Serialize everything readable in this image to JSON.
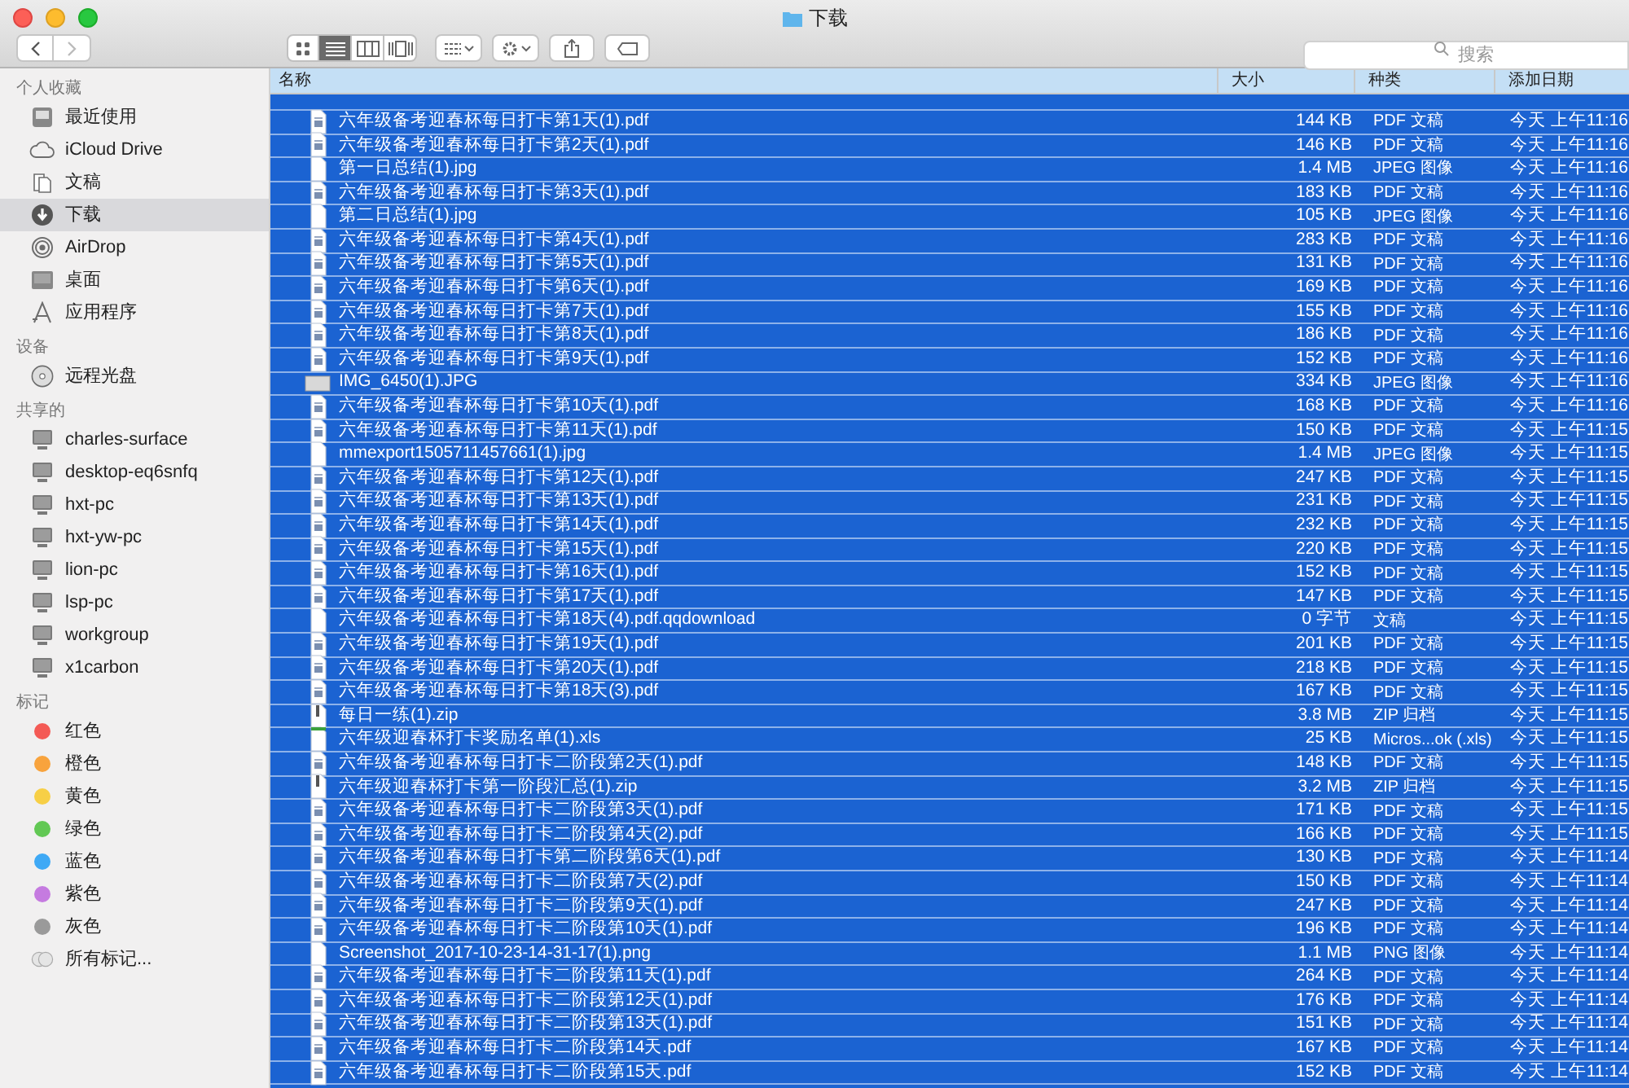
{
  "window": {
    "title": "下载"
  },
  "toolbar": {
    "view_modes": [
      {
        "kind": "icons",
        "selected": false
      },
      {
        "kind": "list",
        "selected": true
      },
      {
        "kind": "columns",
        "selected": false
      },
      {
        "kind": "coverflow",
        "selected": false
      }
    ],
    "search": {
      "placeholder": "搜索"
    }
  },
  "sidebar": {
    "sections": [
      {
        "title": "个人收藏",
        "items": [
          {
            "label": "最近使用",
            "kind": "recents",
            "selected": false
          },
          {
            "label": "iCloud Drive",
            "kind": "cloud",
            "selected": false
          },
          {
            "label": "文稿",
            "kind": "documents",
            "selected": false
          },
          {
            "label": "下载",
            "kind": "downloads",
            "selected": true
          },
          {
            "label": "AirDrop",
            "kind": "airdrop",
            "selected": false
          },
          {
            "label": "桌面",
            "kind": "desktop",
            "selected": false
          },
          {
            "label": "应用程序",
            "kind": "apps",
            "selected": false
          }
        ]
      },
      {
        "title": "设备",
        "items": [
          {
            "label": "远程光盘",
            "kind": "disc",
            "selected": false
          }
        ]
      },
      {
        "title": "共享的",
        "items": [
          {
            "label": "charles-surface",
            "kind": "computer",
            "selected": false
          },
          {
            "label": "desktop-eq6snfq",
            "kind": "computer",
            "selected": false
          },
          {
            "label": "hxt-pc",
            "kind": "computer",
            "selected": false
          },
          {
            "label": "hxt-yw-pc",
            "kind": "computer",
            "selected": false
          },
          {
            "label": "lion-pc",
            "kind": "computer",
            "selected": false
          },
          {
            "label": "lsp-pc",
            "kind": "computer",
            "selected": false
          },
          {
            "label": "workgroup",
            "kind": "computer",
            "selected": false
          },
          {
            "label": "x1carbon",
            "kind": "computer",
            "selected": false
          }
        ]
      },
      {
        "title": "标记",
        "items": [
          {
            "label": "红色",
            "kind": "tag",
            "color": "#f45a55",
            "selected": false
          },
          {
            "label": "橙色",
            "kind": "tag",
            "color": "#f8a33d",
            "selected": false
          },
          {
            "label": "黄色",
            "kind": "tag",
            "color": "#f7cf46",
            "selected": false
          },
          {
            "label": "绿色",
            "kind": "tag",
            "color": "#62c854",
            "selected": false
          },
          {
            "label": "蓝色",
            "kind": "tag",
            "color": "#3fa9f5",
            "selected": false
          },
          {
            "label": "紫色",
            "kind": "tag",
            "color": "#c57be0",
            "selected": false
          },
          {
            "label": "灰色",
            "kind": "tag",
            "color": "#9a9a9a",
            "selected": false
          },
          {
            "label": "所有标记...",
            "kind": "alltags",
            "selected": false
          }
        ]
      }
    ]
  },
  "table": {
    "columns": [
      "名称",
      "大小",
      "种类",
      "添加日期"
    ],
    "rows": [
      {
        "name": "六年级备考迎春杯每日打卡第1天(1).pdf",
        "size": "144 KB",
        "type": "PDF 文稿",
        "date": "今天 上午11:16",
        "kind": "pdf",
        "selected": true
      },
      {
        "name": "六年级备考迎春杯每日打卡第2天(1).pdf",
        "size": "146 KB",
        "type": "PDF 文稿",
        "date": "今天 上午11:16",
        "kind": "pdf",
        "selected": true
      },
      {
        "name": "第一日总结(1).jpg",
        "size": "1.4 MB",
        "type": "JPEG 图像",
        "date": "今天 上午11:16",
        "kind": "image",
        "selected": true
      },
      {
        "name": "六年级备考迎春杯每日打卡第3天(1).pdf",
        "size": "183 KB",
        "type": "PDF 文稿",
        "date": "今天 上午11:16",
        "kind": "pdf",
        "selected": true
      },
      {
        "name": "第二日总结(1).jpg",
        "size": "105 KB",
        "type": "JPEG 图像",
        "date": "今天 上午11:16",
        "kind": "image",
        "selected": true
      },
      {
        "name": "六年级备考迎春杯每日打卡第4天(1).pdf",
        "size": "283 KB",
        "type": "PDF 文稿",
        "date": "今天 上午11:16",
        "kind": "pdf",
        "selected": true
      },
      {
        "name": "六年级备考迎春杯每日打卡第5天(1).pdf",
        "size": "131 KB",
        "type": "PDF 文稿",
        "date": "今天 上午11:16",
        "kind": "pdf",
        "selected": true
      },
      {
        "name": "六年级备考迎春杯每日打卡第6天(1).pdf",
        "size": "169 KB",
        "type": "PDF 文稿",
        "date": "今天 上午11:16",
        "kind": "pdf",
        "selected": true
      },
      {
        "name": "六年级备考迎春杯每日打卡第7天(1).pdf",
        "size": "155 KB",
        "type": "PDF 文稿",
        "date": "今天 上午11:16",
        "kind": "pdf",
        "selected": true
      },
      {
        "name": "六年级备考迎春杯每日打卡第8天(1).pdf",
        "size": "186 KB",
        "type": "PDF 文稿",
        "date": "今天 上午11:16",
        "kind": "pdf",
        "selected": true
      },
      {
        "name": "六年级备考迎春杯每日打卡第9天(1).pdf",
        "size": "152 KB",
        "type": "PDF 文稿",
        "date": "今天 上午11:16",
        "kind": "pdf",
        "selected": true
      },
      {
        "name": "IMG_6450(1).JPG",
        "size": "334 KB",
        "type": "JPEG 图像",
        "date": "今天 上午11:16",
        "kind": "photo",
        "selected": true
      },
      {
        "name": "六年级备考迎春杯每日打卡第10天(1).pdf",
        "size": "168 KB",
        "type": "PDF 文稿",
        "date": "今天 上午11:16",
        "kind": "pdf",
        "selected": true
      },
      {
        "name": "六年级备考迎春杯每日打卡第11天(1).pdf",
        "size": "150 KB",
        "type": "PDF 文稿",
        "date": "今天 上午11:15",
        "kind": "pdf",
        "selected": true
      },
      {
        "name": "mmexport1505711457661(1).jpg",
        "size": "1.4 MB",
        "type": "JPEG 图像",
        "date": "今天 上午11:15",
        "kind": "image",
        "selected": true
      },
      {
        "name": "六年级备考迎春杯每日打卡第12天(1).pdf",
        "size": "247 KB",
        "type": "PDF 文稿",
        "date": "今天 上午11:15",
        "kind": "pdf",
        "selected": true
      },
      {
        "name": "六年级备考迎春杯每日打卡第13天(1).pdf",
        "size": "231 KB",
        "type": "PDF 文稿",
        "date": "今天 上午11:15",
        "kind": "pdf",
        "selected": true
      },
      {
        "name": "六年级备考迎春杯每日打卡第14天(1).pdf",
        "size": "232 KB",
        "type": "PDF 文稿",
        "date": "今天 上午11:15",
        "kind": "pdf",
        "selected": true
      },
      {
        "name": "六年级备考迎春杯每日打卡第15天(1).pdf",
        "size": "220 KB",
        "type": "PDF 文稿",
        "date": "今天 上午11:15",
        "kind": "pdf",
        "selected": true
      },
      {
        "name": "六年级备考迎春杯每日打卡第16天(1).pdf",
        "size": "152 KB",
        "type": "PDF 文稿",
        "date": "今天 上午11:15",
        "kind": "pdf",
        "selected": true
      },
      {
        "name": "六年级备考迎春杯每日打卡第17天(1).pdf",
        "size": "147 KB",
        "type": "PDF 文稿",
        "date": "今天 上午11:15",
        "kind": "pdf",
        "selected": true
      },
      {
        "name": "六年级备考迎春杯每日打卡第18天(4).pdf.qqdownload",
        "size": "0 字节",
        "type": "文稿",
        "date": "今天 上午11:15",
        "kind": "blank",
        "selected": true
      },
      {
        "name": "六年级备考迎春杯每日打卡第19天(1).pdf",
        "size": "201 KB",
        "type": "PDF 文稿",
        "date": "今天 上午11:15",
        "kind": "pdf",
        "selected": true
      },
      {
        "name": "六年级备考迎春杯每日打卡第20天(1).pdf",
        "size": "218 KB",
        "type": "PDF 文稿",
        "date": "今天 上午11:15",
        "kind": "pdf",
        "selected": true
      },
      {
        "name": "六年级备考迎春杯每日打卡第18天(3).pdf",
        "size": "167 KB",
        "type": "PDF 文稿",
        "date": "今天 上午11:15",
        "kind": "pdf",
        "selected": true
      },
      {
        "name": "每日一练(1).zip",
        "size": "3.8 MB",
        "type": "ZIP 归档",
        "date": "今天 上午11:15",
        "kind": "zip",
        "selected": true
      },
      {
        "name": "六年级迎春杯打卡奖励名单(1).xls",
        "size": "25 KB",
        "type": "Micros...ok (.xls)",
        "date": "今天 上午11:15",
        "kind": "sheet",
        "selected": true
      },
      {
        "name": "六年级备考迎春杯每日打卡二阶段第2天(1).pdf",
        "size": "148 KB",
        "type": "PDF 文稿",
        "date": "今天 上午11:15",
        "kind": "pdf",
        "selected": true
      },
      {
        "name": "六年级迎春杯打卡第一阶段汇总(1).zip",
        "size": "3.2 MB",
        "type": "ZIP 归档",
        "date": "今天 上午11:15",
        "kind": "zip",
        "selected": true
      },
      {
        "name": "六年级备考迎春杯每日打卡二阶段第3天(1).pdf",
        "size": "171 KB",
        "type": "PDF 文稿",
        "date": "今天 上午11:15",
        "kind": "pdf",
        "selected": true
      },
      {
        "name": "六年级备考迎春杯每日打卡二阶段第4天(2).pdf",
        "size": "166 KB",
        "type": "PDF 文稿",
        "date": "今天 上午11:15",
        "kind": "pdf",
        "selected": true
      },
      {
        "name": "六年级备考迎春杯每日打卡第二阶段第6天(1).pdf",
        "size": "130 KB",
        "type": "PDF 文稿",
        "date": "今天 上午11:14",
        "kind": "pdf",
        "selected": true
      },
      {
        "name": "六年级备考迎春杯每日打卡二阶段第7天(2).pdf",
        "size": "150 KB",
        "type": "PDF 文稿",
        "date": "今天 上午11:14",
        "kind": "pdf",
        "selected": true
      },
      {
        "name": "六年级备考迎春杯每日打卡二阶段第9天(1).pdf",
        "size": "247 KB",
        "type": "PDF 文稿",
        "date": "今天 上午11:14",
        "kind": "pdf",
        "selected": true
      },
      {
        "name": "六年级备考迎春杯每日打卡二阶段第10天(1).pdf",
        "size": "196 KB",
        "type": "PDF 文稿",
        "date": "今天 上午11:14",
        "kind": "pdf",
        "selected": true
      },
      {
        "name": "Screenshot_2017-10-23-14-31-17(1).png",
        "size": "1.1 MB",
        "type": "PNG 图像",
        "date": "今天 上午11:14",
        "kind": "image",
        "selected": true
      },
      {
        "name": "六年级备考迎春杯每日打卡二阶段第11天(1).pdf",
        "size": "264 KB",
        "type": "PDF 文稿",
        "date": "今天 上午11:14",
        "kind": "pdf",
        "selected": true
      },
      {
        "name": "六年级备考迎春杯每日打卡二阶段第12天(1).pdf",
        "size": "176 KB",
        "type": "PDF 文稿",
        "date": "今天 上午11:14",
        "kind": "pdf",
        "selected": true
      },
      {
        "name": "六年级备考迎春杯每日打卡二阶段第13天(1).pdf",
        "size": "151 KB",
        "type": "PDF 文稿",
        "date": "今天 上午11:14",
        "kind": "pdf",
        "selected": true
      },
      {
        "name": "六年级备考迎春杯每日打卡二阶段第14天.pdf",
        "size": "167 KB",
        "type": "PDF 文稿",
        "date": "今天 上午11:14",
        "kind": "pdf",
        "selected": true
      },
      {
        "name": "六年级备考迎春杯每日打卡二阶段第15天.pdf",
        "size": "152 KB",
        "type": "PDF 文稿",
        "date": "今天 上午11:14",
        "kind": "pdf",
        "selected": true
      }
    ]
  }
}
